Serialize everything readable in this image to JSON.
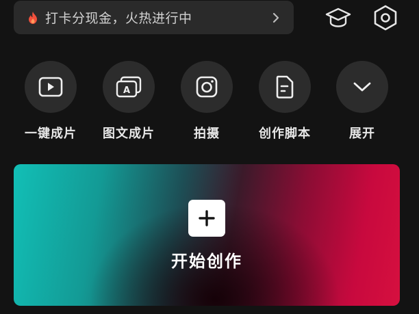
{
  "banner": {
    "text": "打卡分现金，火热进行中",
    "icon": "fire-icon",
    "accent": "#f0503c"
  },
  "top_icons": [
    "graduation-cap-icon",
    "settings-hexagon-icon"
  ],
  "tools": [
    {
      "label": "一键成片",
      "icon": "play-video-icon"
    },
    {
      "label": "图文成片",
      "icon": "image-text-icon"
    },
    {
      "label": "拍摄",
      "icon": "camera-icon"
    },
    {
      "label": "创作脚本",
      "icon": "script-doc-icon"
    },
    {
      "label": "展开",
      "icon": "chevron-down-icon"
    }
  ],
  "create": {
    "label": "开始创作",
    "icon": "plus-icon",
    "gradient": [
      "#12bfb6",
      "#d6103f"
    ]
  }
}
